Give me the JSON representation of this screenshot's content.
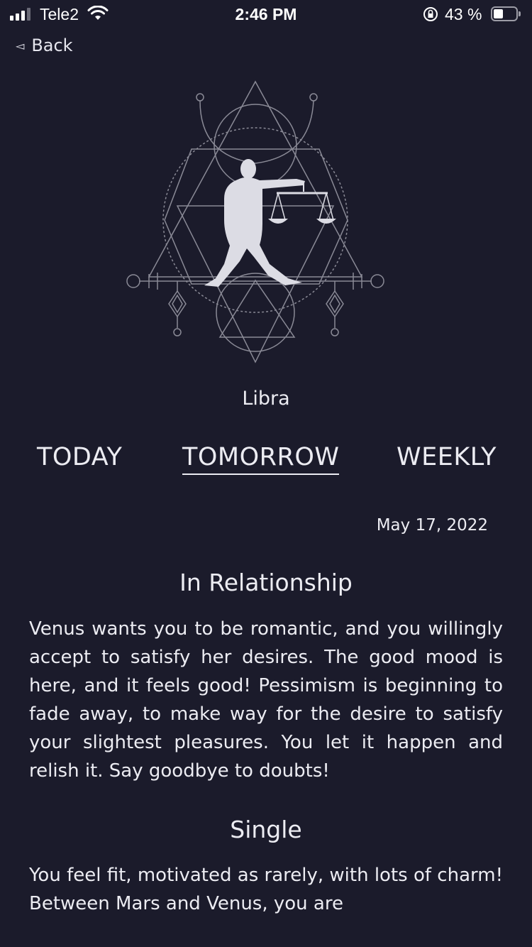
{
  "status_bar": {
    "carrier": "Tele2",
    "time": "2:46 PM",
    "battery_percent": "43 %",
    "battery_level": 0.43
  },
  "nav": {
    "back_label": "Back"
  },
  "sign": {
    "name": "Libra",
    "icon": "libra-zodiac-emblem"
  },
  "tabs": [
    {
      "label": "TODAY",
      "active": false
    },
    {
      "label": "TOMORROW",
      "active": true
    },
    {
      "label": "WEEKLY",
      "active": false
    }
  ],
  "date": "May 17, 2022",
  "sections": [
    {
      "title": "In Relationship",
      "text": "Venus wants you to be romantic, and you willingly accept to satisfy her desires. The good mood is here, and it feels good! Pessimism is beginning to fade away, to make way for the desire to satisfy your slightest pleasures. You let it happen and relish it. Say goodbye to doubts!"
    },
    {
      "title": "Single",
      "text": "You feel fit, motivated as rarely, with lots of charm! Between Mars and Venus, you are"
    }
  ],
  "colors": {
    "background": "#1b1b2b",
    "text": "#ececf2",
    "art_line": "#8a8a96"
  }
}
